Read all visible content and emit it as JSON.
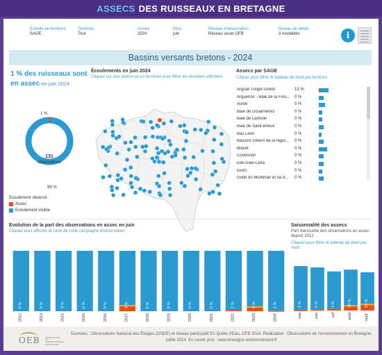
{
  "header": {
    "title_accent": "ASSECS",
    "title_rest": "DES RUISSEAUX EN BRETAGNE"
  },
  "filters": [
    {
      "label": "Echelle de territoire",
      "value": "SAGE"
    },
    {
      "label": "Territoire",
      "value": "Tout"
    },
    {
      "label": "Année",
      "value": "2024"
    },
    {
      "label": "Mois",
      "value": "juin"
    },
    {
      "label": "Réseau d'observation",
      "value": "Réseau usuel OFB"
    },
    {
      "label": "Niveau de détail",
      "value": "3 modalités"
    }
  ],
  "icons": {
    "info": "info-icon",
    "table": "table-icon"
  },
  "banner": {
    "title": "Bassins versants bretons - 2024"
  },
  "summary": {
    "headline": "1 % des ruisseaux sont en assec",
    "headline_suffix": " en juin 2024",
    "donut_total": "131",
    "donut_unit": "observations",
    "pct_assec": "1 %",
    "pct_visible": "99 %",
    "assec_fraction": 0.01
  },
  "legend": {
    "title": "Ecoulement observé",
    "items": [
      {
        "label": "Assec",
        "color": "#e84d1b"
      },
      {
        "label": "Ecoulement visible",
        "color": "#2b9ad0"
      }
    ]
  },
  "map_section": {
    "title": "Écoulements en juin 2024",
    "subtitle": "Cliquez sur une station ou un territoire pour filtrer les données affichées"
  },
  "sage_section": {
    "title": "Assecs par SAGE",
    "subtitle": "Cliquer pour filtrer le tableau de bord par territoire",
    "rows": [
      {
        "name": "Argoat-Trégor-Goëlo",
        "pct": "13 %",
        "total": 8,
        "assec": 1
      },
      {
        "name": "Arguenon - Baie de la Fres...",
        "pct": "0 %",
        "total": 4,
        "assec": 0
      },
      {
        "name": "Aulne",
        "pct": "0 %",
        "total": 5,
        "assec": 0
      },
      {
        "name": "Baie de Douarnenez",
        "pct": "0 %",
        "total": 3,
        "assec": 0
      },
      {
        "name": "Baie de Lannion",
        "pct": "0 %",
        "total": 3,
        "assec": 0
      },
      {
        "name": "Baie de Saint-Brieuc",
        "pct": "0 %",
        "total": 4,
        "assec": 0
      },
      {
        "name": "Bas Léon",
        "pct": "0 %",
        "total": 2,
        "assec": 0
      },
      {
        "name": "Bassins côtiers de la régio...",
        "pct": "0 %",
        "total": 4,
        "assec": 0
      },
      {
        "name": "Blavet",
        "pct": "0 %",
        "total": 7,
        "assec": 0
      },
      {
        "name": "Couesnon",
        "pct": "0 %",
        "total": 4,
        "assec": 0
      },
      {
        "name": "Elle-Isole-Laïta",
        "pct": "0 %",
        "total": 4,
        "assec": 0
      },
      {
        "name": "Elorn",
        "pct": "0 %",
        "total": 3,
        "assec": 0
      },
      {
        "name": "Golfe du Morbihan et ria d...",
        "pct": "0 %",
        "total": 4,
        "assec": 0
      }
    ]
  },
  "evolution": {
    "title": "Evolution de la part des observations en assec en juin",
    "subtitle": "Cliquez pour afficher la carte de cette campagne d'observation"
  },
  "saison": {
    "title": "Saisonnalité des assecs",
    "subtitle": "Part mensuelle des observations en assec depuis 2012",
    "hint": "Cliquez pour filtrer le tableau de bord par mois"
  },
  "chart_data": [
    {
      "type": "bar",
      "title": "Evolution de la part des observations en assec en juin",
      "categories": [
        "2012",
        "2013",
        "2014",
        "2015",
        "2016",
        "2017",
        "2018",
        "2019",
        "2020",
        "2021",
        "2022",
        "2023",
        "2024"
      ],
      "series": [
        {
          "name": "Assec",
          "values": [
            0,
            0,
            0,
            0,
            0,
            8,
            0,
            0,
            0,
            0,
            2,
            6,
            1
          ]
        },
        {
          "name": "Ecoulement visible",
          "values": [
            100,
            100,
            100,
            100,
            100,
            92,
            100,
            100,
            100,
            100,
            98,
            94,
            99
          ]
        }
      ],
      "data_labels": [
        "0 %",
        "0 %",
        "0 %",
        "0 %",
        "0 %",
        "8 %",
        "0 %",
        "0 %",
        "0 %",
        "0 %",
        "2 %",
        "6 %",
        "1 %"
      ],
      "stacked": true,
      "ylim": [
        0,
        100
      ]
    },
    {
      "type": "bar",
      "title": "Saisonnalité des assecs",
      "categories": [
        "mai",
        "juin",
        "juil",
        "août",
        "sept."
      ],
      "series": [
        {
          "name": "Assec",
          "values": [
            1,
            2,
            4,
            10,
            14
          ]
        },
        {
          "name": "Ecoulement visible",
          "values": [
            99,
            98,
            96,
            90,
            86
          ]
        }
      ],
      "data_labels": [
        "1 %",
        "2 %",
        "4 %",
        "10 %",
        "14 %"
      ],
      "stacked": true,
      "ylim": [
        0,
        100
      ]
    }
  ],
  "footer": {
    "text": "Données : Observatoire National des Étiages (ONDE) et réseau participatif En Quête d'Eau, OFB 2024. Réalisation : Observatoire de l'environnement en Bretagne, juillet 2024. En savoir plus : www.bretagne-environnement.fr",
    "logo_text": "OEB",
    "logo_small": "OBSERVATOIRE DE L'ENVIRONNEMENT EN BRETAGNE"
  }
}
